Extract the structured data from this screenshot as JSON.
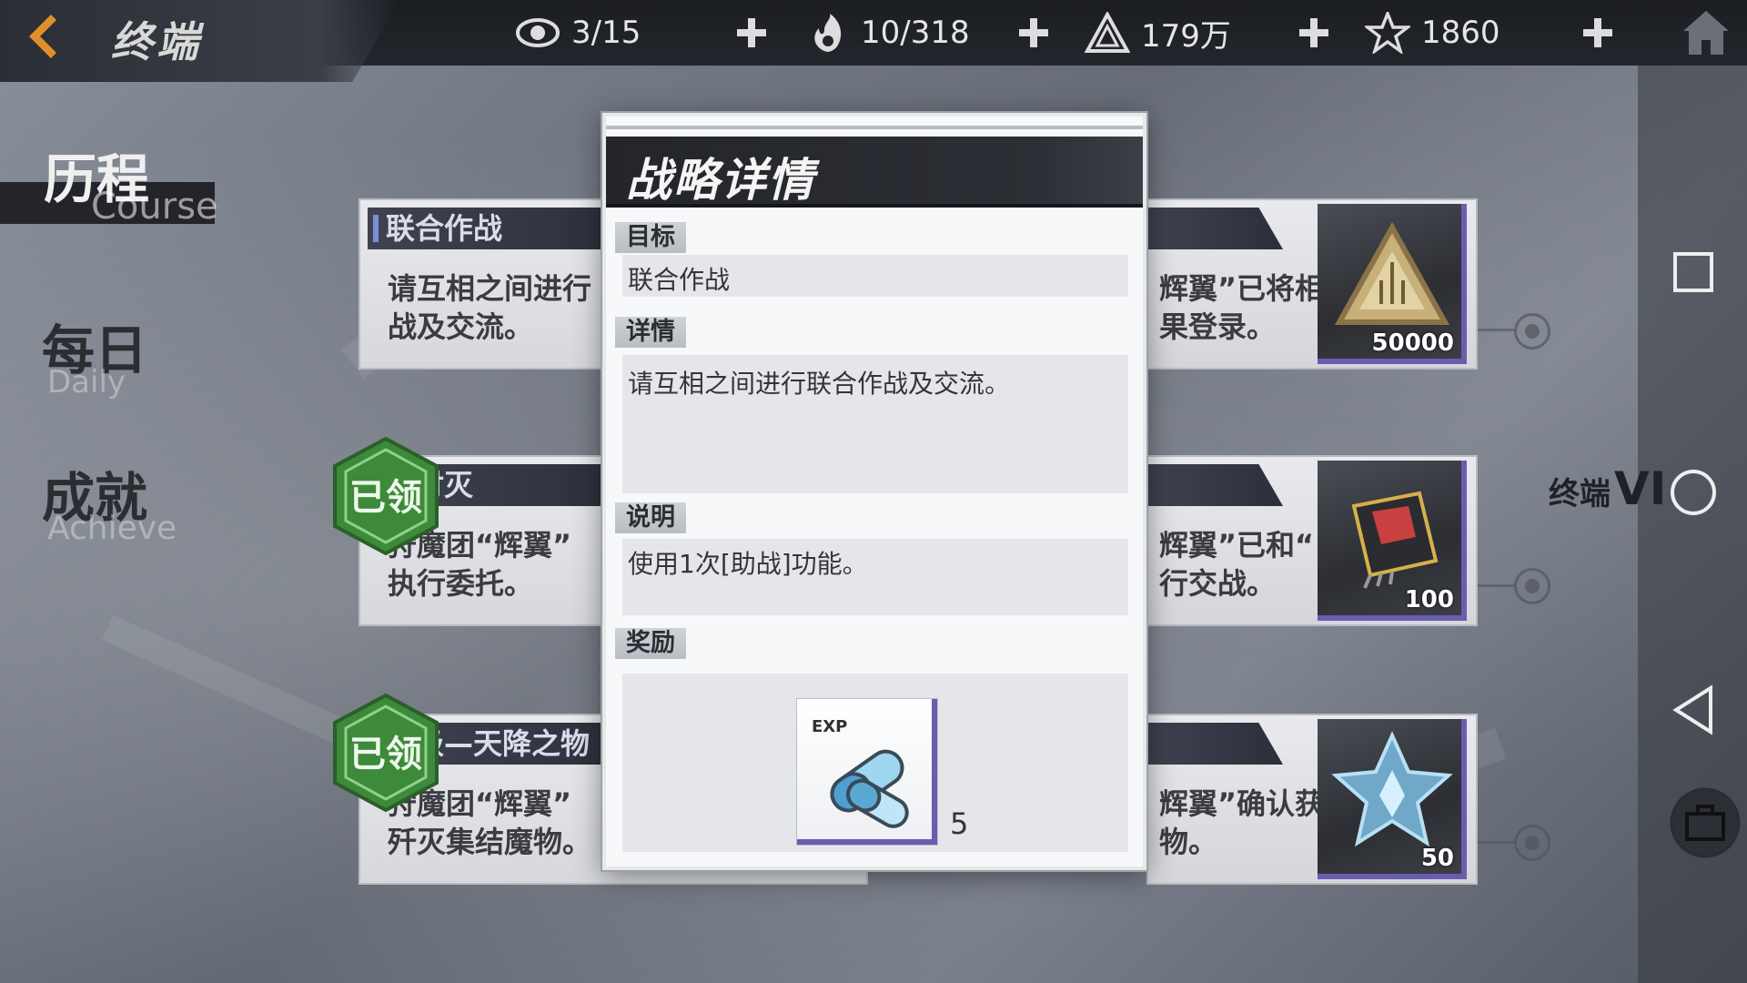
{
  "header": {
    "title": "终端",
    "resources": [
      {
        "icon": "eye-icon",
        "value": "3/15"
      },
      {
        "icon": "flame-hand-icon",
        "value": "10/318"
      },
      {
        "icon": "triangle-crystal-icon",
        "value": "179万"
      },
      {
        "icon": "star-gem-icon",
        "value": "1860"
      }
    ]
  },
  "nav": {
    "items": [
      {
        "cn": "历程",
        "en": "Course"
      },
      {
        "cn": "每日",
        "en": "Daily"
      },
      {
        "cn": "成就",
        "en": "Achieve"
      }
    ]
  },
  "tasks": [
    {
      "title": "联合作战",
      "desc": "请互相之间进行\n战及交流。",
      "right_desc": "辉翼”已将相\n果登录。",
      "reward_qty": "50000",
      "claimed": false
    },
    {
      "title": "护讨灭",
      "desc": "狩魔团“辉翼”\n执行委托。",
      "right_desc": "辉翼”已和“\n行交战。",
      "reward_qty": "100",
      "claimed": true
    },
    {
      "title": "三级—天降之物",
      "desc": "狩魔团“辉翼”\n歼灭集结魔物。",
      "right_desc": "辉翼”确认获\n物。",
      "reward_qty": "50",
      "claimed": true
    }
  ],
  "stamp_text": "已领",
  "dialog": {
    "title": "战略详情",
    "target_label": "目标",
    "target_value": "联合作战",
    "detail_label": "详情",
    "detail_value": "请互相之间进行联合作战及交流。",
    "note_label": "说明",
    "note_value": "使用1次[助战]功能。",
    "reward_label": "奖励",
    "reward_item": {
      "icon_text": "EXP",
      "qty": "5"
    }
  },
  "side": {
    "label_prefix": "终端",
    "label_roman": "VI"
  },
  "colors": {
    "accent_purple": "#6a5db0",
    "stamp_green": "#3d8a3a",
    "back_orange": "#e0902a"
  }
}
